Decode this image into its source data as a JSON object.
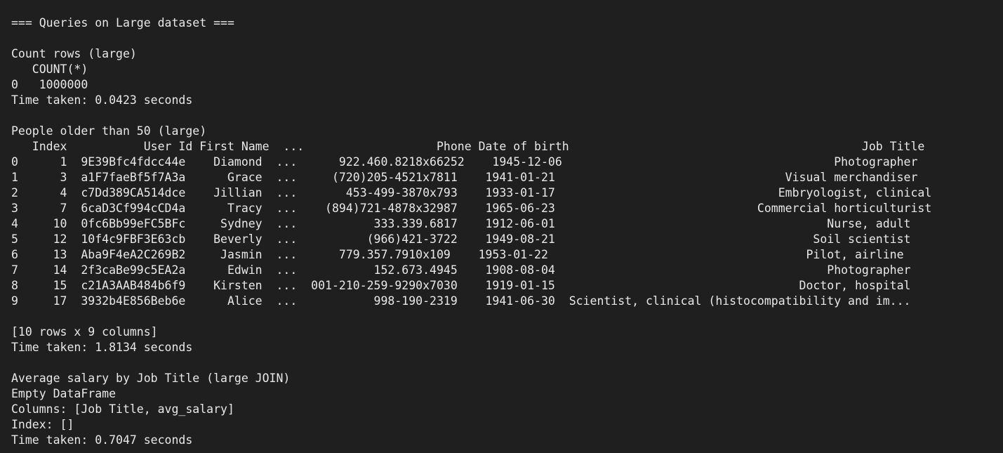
{
  "terminal": {
    "lines": [
      "=== Queries on Large dataset ===",
      "",
      "Count rows (large)",
      "   COUNT(*)",
      "0   1000000",
      "Time taken: 0.0423 seconds",
      "",
      "People older than 50 (large)",
      "   Index           User Id First Name  ...                   Phone Date of birth                                          Job Title",
      "0      1  9E39Bfc4fdcc44e    Diamond  ...      922.460.8218x66252    1945-12-06                                       Photographer",
      "1      3  a1F7faeBf5f7A3a      Grace  ...     (720)205-4521x7811    1941-01-21                                 Visual merchandiser",
      "2      4  c7Dd389CA514dce    Jillian  ...       453-499-3870x793    1933-01-17                                Embryologist, clinical",
      "3      7  6caD3Cf994cCD4a      Tracy  ...    (894)721-4878x32987    1965-06-23                             Commercial horticulturist",
      "4     10  0fc6Bb99eFC5BFc     Sydney  ...           333.339.6817    1912-06-01                                       Nurse, adult",
      "5     12  10f4c9FBF3E63cb    Beverly  ...          (966)421-3722    1949-08-21                                     Soil scientist",
      "6     13  Aba9F4eA2C269B2     Jasmin  ...      779.357.7910x109    1953-01-22                                     Pilot, airline",
      "7     14  2f3caBe99c5EA2a      Edwin  ...           152.673.4945    1908-08-04                                       Photographer",
      "8     15  c21A3AAB484b6f9    Kirsten  ...  001-210-259-9290x7030    1919-01-15                                   Doctor, hospital",
      "9     17  3932b4E856Beb6e      Alice  ...           998-190-2319    1941-06-30  Scientist, clinical (histocompatibility and im...",
      "",
      "[10 rows x 9 columns]",
      "Time taken: 1.8134 seconds",
      "",
      "Average salary by Job Title (large JOIN)",
      "Empty DataFrame",
      "Columns: [Job Title, avg_salary]",
      "Index: []",
      "Time taken: 0.7047 seconds"
    ]
  }
}
